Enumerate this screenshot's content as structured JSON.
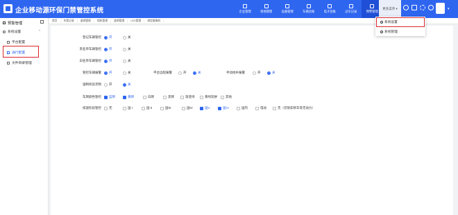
{
  "app": {
    "title": "企业移动源环保门禁管控系统"
  },
  "topnav": [
    {
      "label": "企业管理",
      "active": false
    },
    {
      "label": "场地管理",
      "active": false
    },
    {
      "label": "设备管理",
      "active": false
    },
    {
      "label": "车辆台账",
      "active": false
    },
    {
      "label": "电子台账",
      "active": false
    },
    {
      "label": "过车记录",
      "active": false
    },
    {
      "label": "预警管理",
      "active": true
    }
  ],
  "header": {
    "more_label": "更多菜单"
  },
  "dropdown": [
    {
      "label": "系统设置",
      "icon": "settings-icon",
      "highlighted": true
    },
    {
      "label": "系统管理",
      "icon": "gear-icon",
      "highlighted": false
    }
  ],
  "sidebar": {
    "title": "预警管理",
    "group": "系统设置",
    "items": [
      {
        "label": "平台配置",
        "active": false
      },
      {
        "label": "通行配置",
        "active": true
      },
      {
        "label": "文件目录管理",
        "active": false
      }
    ]
  },
  "tabs": [
    "首页",
    "车管记录",
    "道闸管理",
    "相机管理",
    "道闸管理",
    "LED管理",
    "绑定摄像机"
  ],
  "form": {
    "rows": [
      {
        "label": "登记车辆管控",
        "options": [
          {
            "t": "开",
            "on": true
          },
          {
            "t": "关",
            "on": false
          }
        ]
      },
      {
        "label": "黑名单车辆管控",
        "options": [
          {
            "t": "开",
            "on": true
          },
          {
            "t": "关",
            "on": false
          }
        ]
      },
      {
        "label": "白名单车辆管控",
        "options": [
          {
            "t": "开",
            "on": true
          },
          {
            "t": "关",
            "on": false
          }
        ]
      },
      {
        "label": "管控车辆报警",
        "options": [
          {
            "t": "开",
            "on": true
          },
          {
            "t": "关",
            "on": false
          }
        ]
      },
      {
        "label": "强制校验货物",
        "options": [
          {
            "t": "开",
            "on": false
          },
          {
            "t": "关",
            "on": true
          }
        ]
      }
    ],
    "inline": [
      {
        "label": "平台远程报警",
        "options": [
          {
            "t": "开",
            "on": false
          },
          {
            "t": "关",
            "on": true
          }
        ]
      },
      {
        "label": "手动抬杆报警",
        "options": [
          {
            "t": "开",
            "on": false
          },
          {
            "t": "关",
            "on": true
          }
        ]
      }
    ],
    "color_label": "车牌颜色管控",
    "colors": [
      {
        "t": "蓝牌",
        "on": true
      },
      {
        "t": "黄牌",
        "on": true
      },
      {
        "t": "白牌",
        "on": false
      },
      {
        "t": "黑牌",
        "on": false
      },
      {
        "t": "渐变绿",
        "on": false
      },
      {
        "t": "黄绿双拼",
        "on": false
      },
      {
        "t": "其他",
        "on": false
      }
    ],
    "stage_label": "排放阶段管控",
    "stages": [
      {
        "t": "无",
        "on": false
      },
      {
        "t": "国 I",
        "on": false
      },
      {
        "t": "国 II",
        "on": false
      },
      {
        "t": "国III",
        "on": false
      },
      {
        "t": "国IV",
        "on": false
      },
      {
        "t": "国V",
        "on": true
      },
      {
        "t": "国VI",
        "on": true
      },
      {
        "t": "国内",
        "on": false
      },
      {
        "t": "电动",
        "on": false
      },
      {
        "t": "无（仅限非移车等无动力）",
        "on": false
      }
    ]
  }
}
